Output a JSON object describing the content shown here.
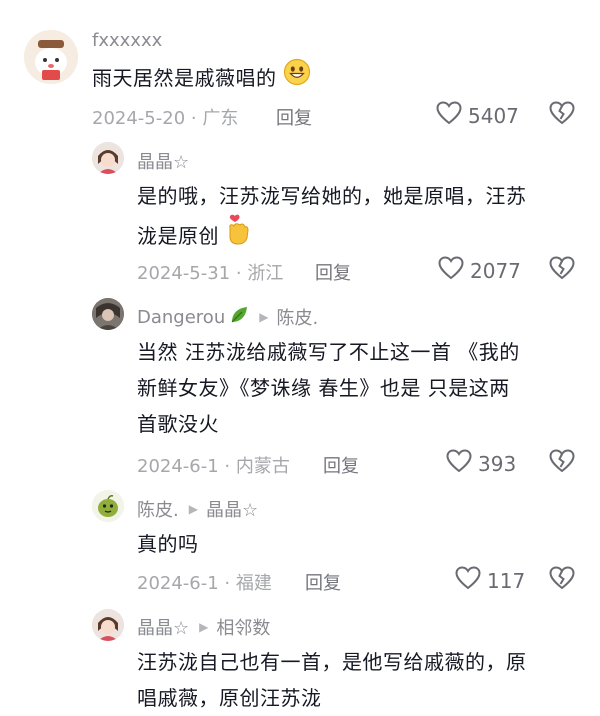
{
  "comments": [
    {
      "username": "fxxxxxx",
      "text": "雨天居然是戚薇唱的",
      "emoji": "grinning-face",
      "date": "2024-5-20",
      "location": "广东",
      "reply_label": "回复",
      "likes": "5407"
    },
    {
      "username": "晶晶☆",
      "text_lines": [
        "是的哦，汪苏泷写给她的，她是原唱，汪苏",
        "泷是原创"
      ],
      "emoji": "finger-heart",
      "date": "2024-5-31",
      "location": "浙江",
      "reply_label": "回复",
      "likes": "2077"
    },
    {
      "username": "Dangerou",
      "reply_to": "陈皮.",
      "text_lines": [
        "当然 汪苏泷给戚薇写了不止这一首  《我的",
        "新鲜女友》《梦诛缘 春生》也是  只是这两",
        "首歌没火"
      ],
      "date": "2024-6-1",
      "location": "内蒙古",
      "reply_label": "回复",
      "likes": "393"
    },
    {
      "username": "陈皮.",
      "reply_to": "晶晶☆",
      "text": "真的吗",
      "date": "2024-6-1",
      "location": "福建",
      "reply_label": "回复",
      "likes": "117"
    },
    {
      "username": "晶晶☆",
      "reply_to": "相邻数",
      "text_lines": [
        "汪苏泷自己也有一首，是他写给戚薇的，原",
        "唱戚薇，原创汪苏泷"
      ]
    }
  ],
  "colors": {
    "text": "#161823",
    "meta": "#a6a7ab",
    "icon": "#6a6b72"
  }
}
